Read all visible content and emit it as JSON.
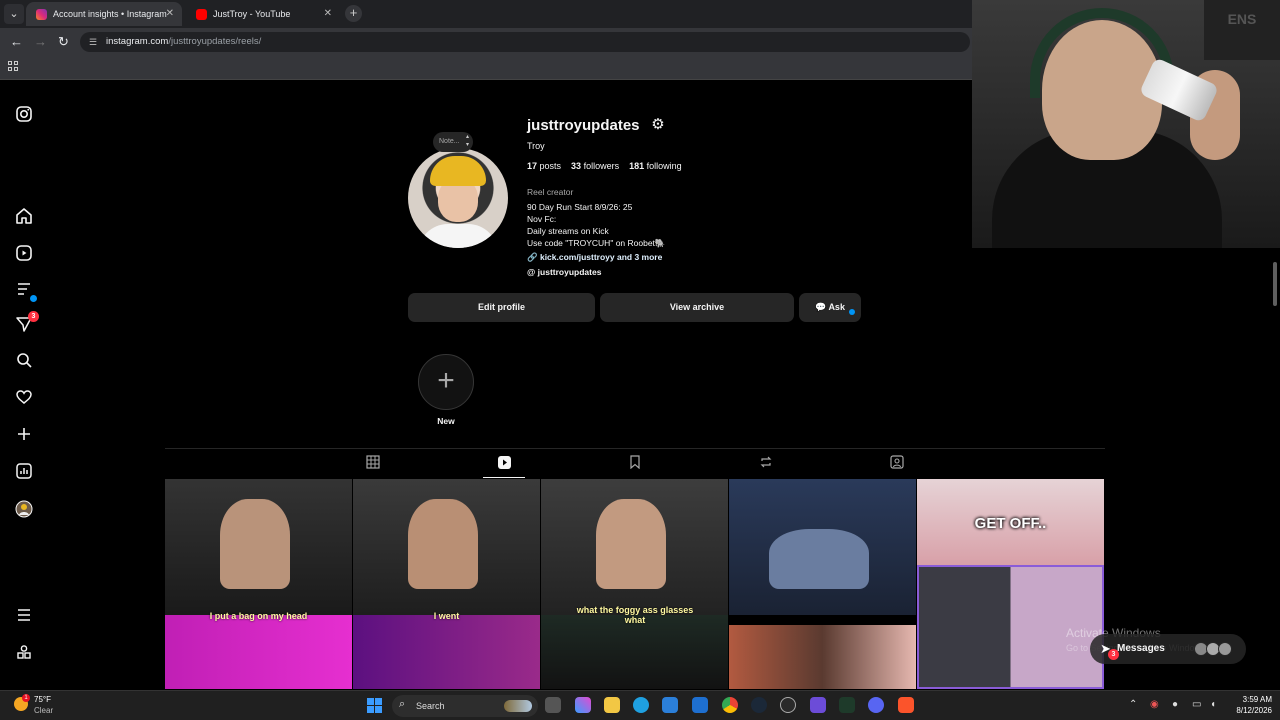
{
  "browser": {
    "tabs": [
      {
        "title": "Account insights • Instagram",
        "active": true
      },
      {
        "title": "JustTroy - YouTube",
        "active": false
      }
    ],
    "url_host": "instagram.com",
    "url_path": "/justtroyupdates/reels/"
  },
  "sidenav": {
    "items": [
      {
        "name": "instagram-logo-icon"
      },
      {
        "name": "home-icon"
      },
      {
        "name": "reels-icon"
      },
      {
        "name": "explore-icon"
      },
      {
        "name": "messages-icon",
        "badge": "3"
      },
      {
        "name": "search-icon"
      },
      {
        "name": "notifications-icon"
      },
      {
        "name": "create-icon"
      },
      {
        "name": "dashboard-icon"
      },
      {
        "name": "profile-icon"
      },
      {
        "name": "more-icon"
      },
      {
        "name": "also-from-meta-icon"
      }
    ]
  },
  "profile": {
    "note_placeholder": "Note...",
    "username": "justtroyupdates",
    "full_name": "Troy",
    "posts_count": "17",
    "posts_label": "posts",
    "followers_count": "33",
    "followers_label": "followers",
    "following_count": "181",
    "following_label": "following",
    "category": "Reel creator",
    "bio_lines": [
      "90 Day Run Start 8/9/26: 25",
      "Nov Fc:",
      "Daily streams on Kick",
      "Use code \"TROYCUH\" on Roobet🐘"
    ],
    "link": "kick.com/justtroyy and 3 more",
    "threads_handle": "justtroyupdates",
    "edit_profile_label": "Edit profile",
    "view_archive_label": "View archive",
    "ask_label": "Ask",
    "new_highlight_label": "New"
  },
  "grid": {
    "reels": [
      {
        "caption": "I put a bag on my head",
        "top_color": "#2a2a2a",
        "bottom_color": "#c01fb5"
      },
      {
        "caption": "I went",
        "top_color": "#2d2d2d",
        "bottom_color": "#7a1aa8"
      },
      {
        "caption": "what the foggy ass glasses what",
        "top_color": "#333333",
        "bottom_color": "#1d2a24"
      },
      {
        "caption": "",
        "top_color": "#2a3a5a",
        "bottom_color": "#b25a40"
      },
      {
        "caption": "GET OFF..",
        "top_color": "#e6d3d6",
        "bottom_color": "#3b3b44"
      }
    ]
  },
  "webcam": {
    "poster_text": "ENS"
  },
  "overlay": {
    "activate_title": "Activate Windows",
    "activate_sub": "Go to Settings to activate Windows.",
    "messages_label": "Messages",
    "messages_badge": "3"
  },
  "taskbar": {
    "weather_temp": "75°F",
    "weather_condition": "Clear",
    "weather_badge": "1",
    "search_label": "Search",
    "time": "3:59 AM",
    "date": "8/12/2026"
  },
  "colors": {
    "accent_blue": "#0095f6",
    "badge_red": "#ff3040",
    "button_bg": "#262626",
    "page_bg": "#000000"
  }
}
